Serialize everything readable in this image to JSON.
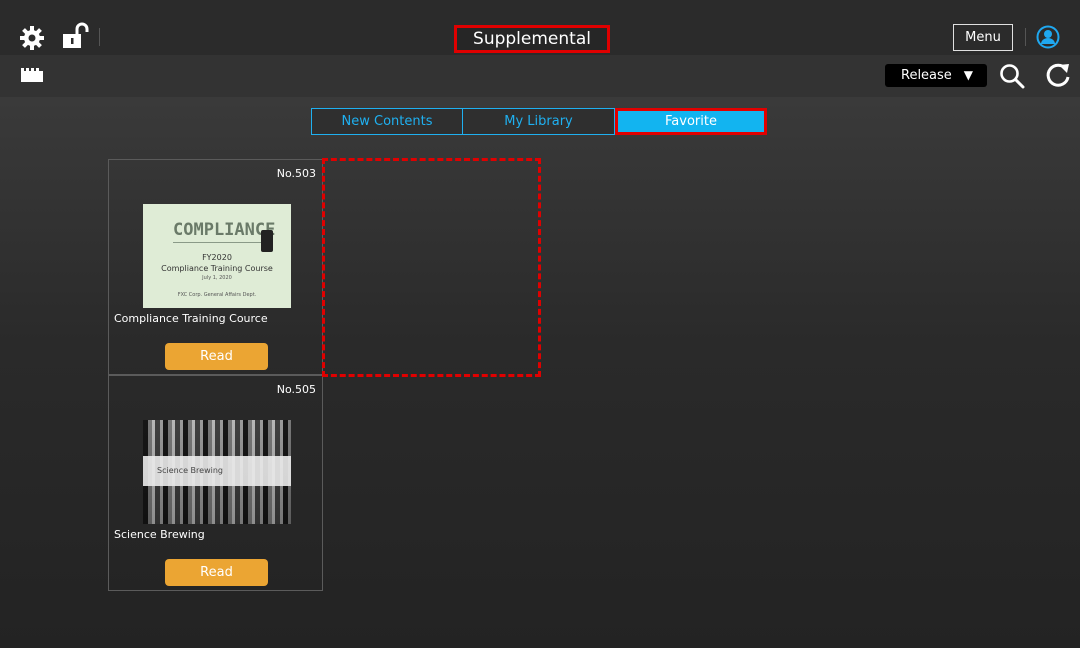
{
  "header": {
    "title": "Supplemental",
    "menu_label": "Menu",
    "icons": [
      "gear-icon",
      "unlock-icon",
      "user-icon"
    ]
  },
  "toolbar": {
    "release_label": "Release",
    "release_arrow": "▼",
    "icons": [
      "video-icon",
      "search-icon",
      "refresh-icon"
    ]
  },
  "tabs": [
    {
      "label": "New Contents",
      "active": false
    },
    {
      "label": "My Library",
      "active": false
    },
    {
      "label": "Favorite",
      "active": true
    }
  ],
  "items": [
    {
      "number": "No.503",
      "title": "Compliance Training Cource",
      "read_label": "Read",
      "thumb": {
        "heading": "COMPLIANCE",
        "line1": "FY2020",
        "line2": "Compliance Training Course",
        "line3": "July 1, 2020",
        "line4": "FXC Corp. General Affairs Dept."
      }
    },
    {
      "number": "No.505",
      "title": "Science Brewing",
      "read_label": "Read",
      "thumb": {
        "caption": "Science Brewing"
      }
    }
  ],
  "colors": {
    "accent": "#12b4f0",
    "read_button": "#eba533",
    "highlight": "#e00000"
  }
}
